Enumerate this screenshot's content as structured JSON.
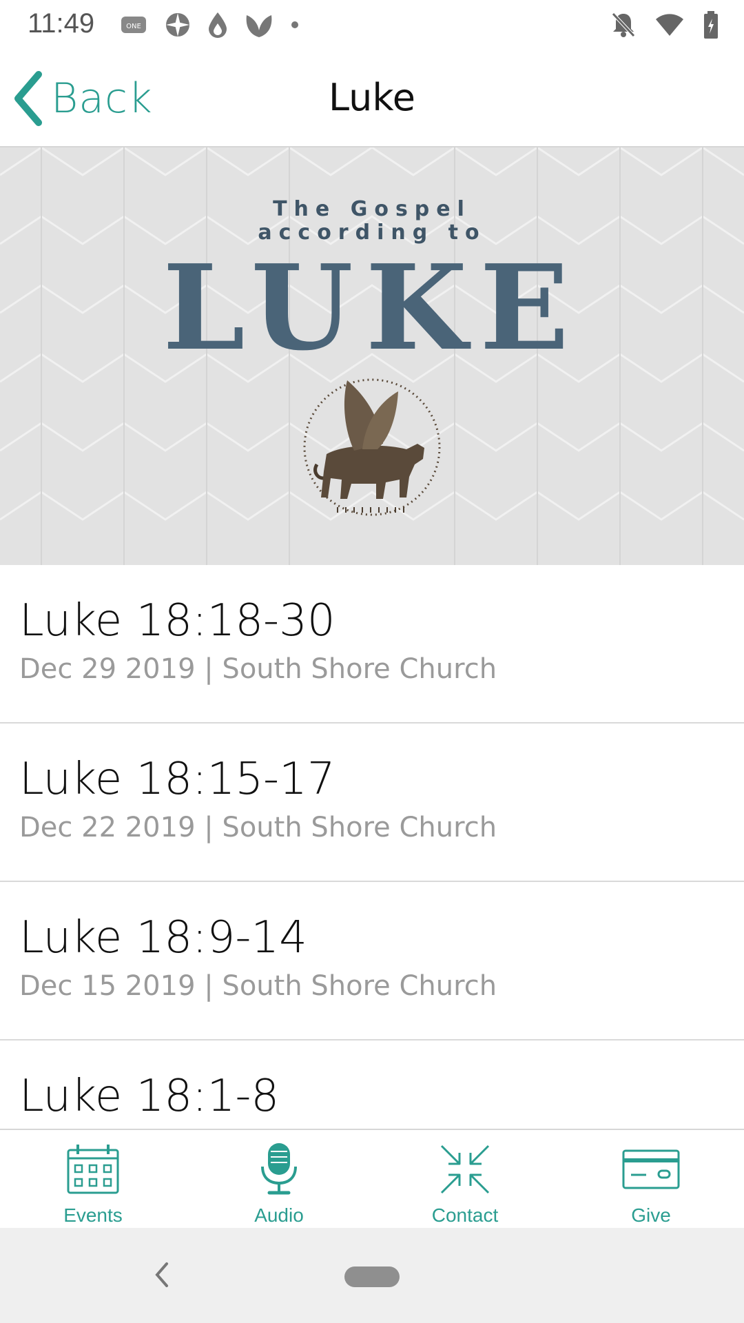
{
  "status_bar": {
    "time": "11:49",
    "left_icons": [
      "app-logo-icon",
      "compass-icon",
      "drop-icon",
      "leaf-icon",
      "dot-icon"
    ],
    "right_icons": [
      "bell-off-icon",
      "wifi-icon",
      "battery-icon"
    ]
  },
  "nav": {
    "back_label": "Back",
    "title": "Luke"
  },
  "hero": {
    "line1": "The Gospel",
    "line2": "according to",
    "title": "LUKE",
    "emblem": "winged-ox-icon"
  },
  "sermons": [
    {
      "title": "Luke 18:18-30",
      "meta": "Dec 29 2019 | South Shore Church"
    },
    {
      "title": "Luke 18:15-17",
      "meta": "Dec 22 2019 | South Shore Church"
    },
    {
      "title": "Luke 18:9-14",
      "meta": "Dec 15 2019 | South Shore Church"
    },
    {
      "title": "Luke 18:1-8",
      "meta": ""
    }
  ],
  "tabs": [
    {
      "label": "Events",
      "icon": "calendar-icon"
    },
    {
      "label": "Audio",
      "icon": "microphone-icon"
    },
    {
      "label": "Contact",
      "icon": "arrows-in-icon"
    },
    {
      "label": "Give",
      "icon": "credit-card-icon"
    }
  ],
  "colors": {
    "accent": "#2a9d90",
    "hero_text": "#4a6478",
    "meta_text": "#9a9a9a"
  }
}
